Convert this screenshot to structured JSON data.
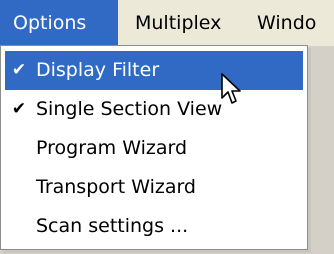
{
  "menubar": {
    "items": [
      {
        "label": "Options"
      },
      {
        "label": "Multiplex"
      },
      {
        "label": "Windo"
      }
    ]
  },
  "dropdown": {
    "items": [
      {
        "label": "Display Filter",
        "checked": true,
        "highlighted": true
      },
      {
        "label": "Single Section View",
        "checked": true,
        "highlighted": false
      },
      {
        "label": "Program Wizard",
        "checked": false,
        "highlighted": false
      },
      {
        "label": "Transport Wizard",
        "checked": false,
        "highlighted": false
      },
      {
        "label": "Scan settings ...",
        "checked": false,
        "highlighted": false
      }
    ]
  },
  "icons": {
    "check": "✔",
    "cursor": "mouse-pointer-icon"
  },
  "colors": {
    "highlight": "#316ac5",
    "menubar_bg": "#ece9d8",
    "menu_bg": "#ffffff"
  }
}
